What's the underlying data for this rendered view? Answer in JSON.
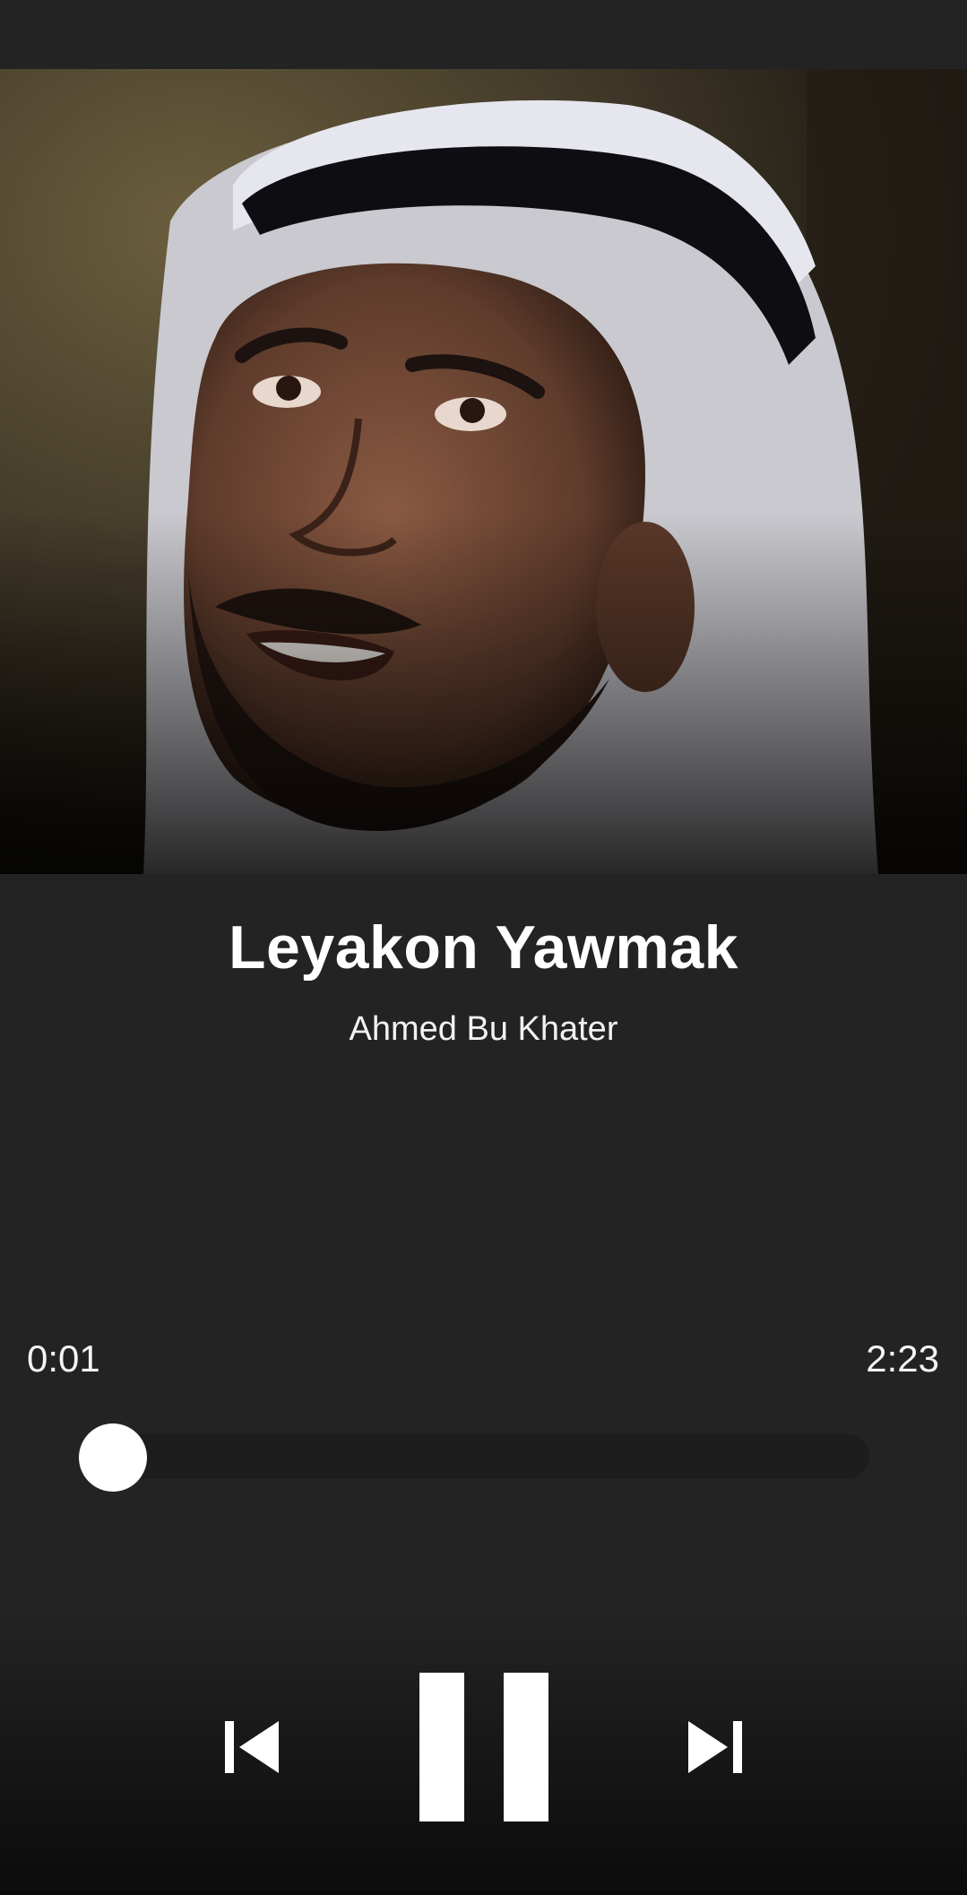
{
  "now_playing": {
    "title": "Leyakon Yawmak",
    "artist": "Ahmed Bu Khater",
    "artwork_icon": "album-artwork-portrait"
  },
  "progress": {
    "elapsed": "0:01",
    "total": "2:23",
    "fraction": 0.007
  },
  "controls": {
    "previous_icon": "skip-previous-icon",
    "pause_icon": "pause-icon",
    "next_icon": "skip-next-icon"
  },
  "colors": {
    "background": "#232323",
    "seek_track": "#1d1d1d",
    "seek_thumb": "#ffffff",
    "text": "#ffffff"
  }
}
